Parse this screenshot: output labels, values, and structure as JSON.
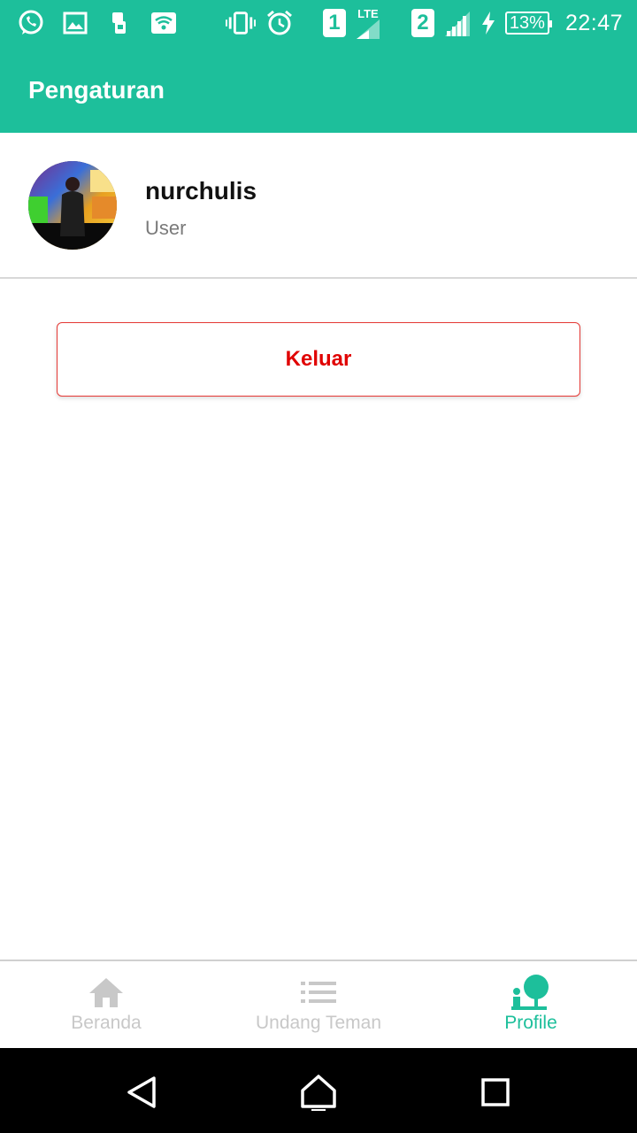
{
  "status_bar": {
    "sim1": "1",
    "sim2": "2",
    "network": "LTE",
    "battery": "13%",
    "time": "22:47",
    "icons": [
      "whatsapp-icon",
      "gallery-icon",
      "sim-toolkit-icon",
      "wifi-icon",
      "vibrate-icon",
      "alarm-icon",
      "signal-icon",
      "charging-icon"
    ]
  },
  "app_bar": {
    "title": "Pengaturan"
  },
  "profile": {
    "name": "nurchulis",
    "role": "User"
  },
  "logout_button": {
    "label": "Keluar",
    "color": "#e00000"
  },
  "bottom_nav": {
    "items": [
      {
        "label": "Beranda",
        "icon": "home-icon",
        "active": false
      },
      {
        "label": "Undang Teman",
        "icon": "list-icon",
        "active": false
      },
      {
        "label": "Profile",
        "icon": "profile-icon",
        "active": true
      }
    ]
  },
  "colors": {
    "primary": "#1dbf9b",
    "inactive": "#c8c8c8",
    "danger": "#e00000"
  }
}
